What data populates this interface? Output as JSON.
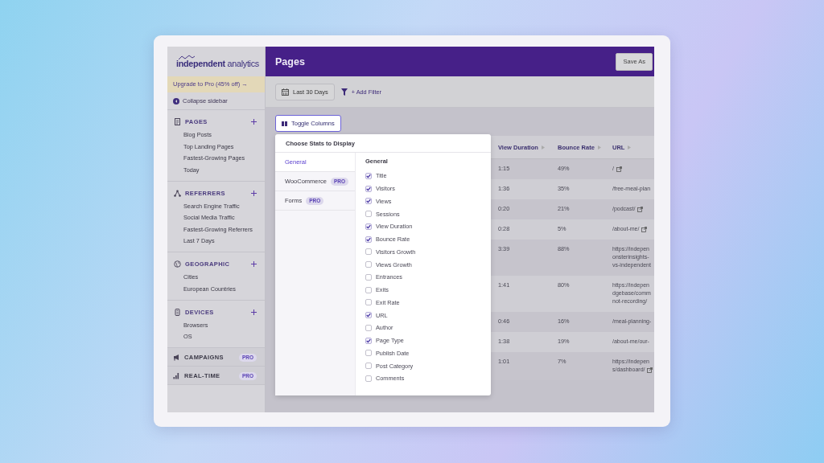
{
  "logo": "**independent** analytics",
  "sidebar": {
    "upgrade": "Upgrade to Pro (45% off) →",
    "collapse": "Collapse sidebar",
    "sections": [
      {
        "kind": "pages",
        "title": "PAGES",
        "items": [
          "Blog Posts",
          "Top Landing Pages",
          "Fastest-Growing Pages",
          "Today"
        ]
      },
      {
        "kind": "referrers",
        "title": "REFERRERS",
        "items": [
          "Search Engine Traffic",
          "Social Media Traffic",
          "Fastest-Growing Referrers",
          "Last 7 Days"
        ]
      },
      {
        "kind": "geographic",
        "title": "GEOGRAPHIC",
        "items": [
          "Cities",
          "European Countries"
        ]
      },
      {
        "kind": "devices",
        "title": "DEVICES",
        "items": [
          "Browsers",
          "OS"
        ]
      },
      {
        "kind": "campaigns",
        "title": "CAMPAIGNS",
        "badge": "PRO"
      },
      {
        "kind": "realtime",
        "title": "REAL-TIME",
        "badge": "PRO"
      }
    ]
  },
  "header": {
    "title": "Pages",
    "button": "Save As"
  },
  "toolbar": {
    "date": "Last 30 Days",
    "filter": "+ Add Filter"
  },
  "toggle": "Toggle Columns",
  "popup": {
    "title": "Choose Stats to Display",
    "tabs": [
      {
        "label": "General",
        "selected": true
      },
      {
        "label": "WooCommerce",
        "badge": "PRO",
        "selected": false
      },
      {
        "label": "Forms",
        "badge": "PRO",
        "selected": false
      }
    ],
    "heading": "General",
    "options": [
      {
        "label": "Title",
        "checked": true
      },
      {
        "label": "Visitors",
        "checked": true
      },
      {
        "label": "Views",
        "checked": true
      },
      {
        "label": "Sessions",
        "checked": false
      },
      {
        "label": "View Duration",
        "checked": true
      },
      {
        "label": "Bounce Rate",
        "checked": true
      },
      {
        "label": "Visitors Growth",
        "checked": false
      },
      {
        "label": "Views Growth",
        "checked": false
      },
      {
        "label": "Entrances",
        "checked": false
      },
      {
        "label": "Exits",
        "checked": false
      },
      {
        "label": "Exit Rate",
        "checked": false
      },
      {
        "label": "URL",
        "checked": true
      },
      {
        "label": "Author",
        "checked": false
      },
      {
        "label": "Page Type",
        "checked": true
      },
      {
        "label": "Publish Date",
        "checked": false
      },
      {
        "label": "Post Category",
        "checked": false
      },
      {
        "label": "Comments",
        "checked": false
      }
    ]
  },
  "table": {
    "columns": [
      "View Duration",
      "Bounce Rate",
      "URL"
    ],
    "rows": [
      {
        "cells": [
          "1:15",
          "49%"
        ],
        "url": [
          "/"
        ],
        "link_icon": true
      },
      {
        "cells": [
          "1:36",
          "35%"
        ],
        "url": [
          "/free-meal-plan"
        ],
        "link_icon": false
      },
      {
        "cells": [
          "0:20",
          "21%"
        ],
        "url": [
          "/podcast/"
        ],
        "link_icon": true
      },
      {
        "cells": [
          "0:28",
          "5%"
        ],
        "url": [
          "/about-me/"
        ],
        "link_icon": true
      },
      {
        "cells": [
          "3:39",
          "88%"
        ],
        "url": [
          "https://indepen",
          "onsterinsights-",
          "vs-independent"
        ],
        "link_icon": false
      },
      {
        "cells": [
          "1:41",
          "80%"
        ],
        "url": [
          "https://indepen",
          "dgebase/comm",
          "not-recording/"
        ],
        "link_icon": false
      },
      {
        "cells": [
          "0:46",
          "16%"
        ],
        "url": [
          "/meal-planning-"
        ],
        "link_icon": false
      },
      {
        "cells": [
          "1:38",
          "19%"
        ],
        "url": [
          "/about-me/our-"
        ],
        "link_icon": false
      },
      {
        "cells": [
          "1:01",
          "7%"
        ],
        "url": [
          "https://indepen",
          "s/dashboard/"
        ],
        "link_icon": true
      }
    ]
  }
}
